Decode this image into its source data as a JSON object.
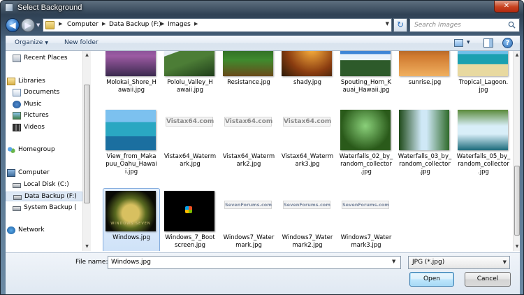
{
  "window": {
    "title": "Select Background",
    "close_glyph": "✕"
  },
  "nav": {
    "back_glyph": "◀",
    "forward_glyph": "▶",
    "refresh_glyph": "↻"
  },
  "address": {
    "crumbs": [
      "Computer",
      "Data Backup (F:)",
      "Images"
    ]
  },
  "search": {
    "placeholder": "Search Images"
  },
  "toolbar": {
    "organize": "Organize",
    "new_folder": "New folder",
    "help_glyph": "?"
  },
  "sidebar": {
    "items": [
      {
        "label": "Recent Places",
        "icon": "recent-places-icon"
      },
      {
        "label": "Libraries",
        "icon": "libraries-icon"
      },
      {
        "label": "Documents",
        "icon": "documents-icon"
      },
      {
        "label": "Music",
        "icon": "music-icon"
      },
      {
        "label": "Pictures",
        "icon": "pictures-icon"
      },
      {
        "label": "Videos",
        "icon": "videos-icon"
      },
      {
        "label": "Homegroup",
        "icon": "homegroup-icon"
      },
      {
        "label": "Computer",
        "icon": "computer-icon"
      },
      {
        "label": "Local Disk (C:)",
        "icon": "drive-icon"
      },
      {
        "label": "Data Backup (F:)",
        "icon": "drive-icon"
      },
      {
        "label": "System Backup (",
        "icon": "drive-icon"
      },
      {
        "label": "Network",
        "icon": "network-icon"
      }
    ]
  },
  "files": [
    {
      "name": "Molokai_Shore_Hawaii.jpg",
      "lines": [
        "Molokai_Shore_H",
        "awaii.jpg"
      ]
    },
    {
      "name": "Pololu_Valley_Hawaii.jpg",
      "lines": [
        "Pololu_Valley_H",
        "awaii.jpg"
      ]
    },
    {
      "name": "Resistance.jpg",
      "lines": [
        "Resistance.jpg"
      ]
    },
    {
      "name": "shady.jpg",
      "lines": [
        "shady.jpg"
      ]
    },
    {
      "name": "Spouting_Horn_Kauai_Hawaii.jpg",
      "lines": [
        "Spouting_Horn_K",
        "auai_Hawaii.jpg"
      ]
    },
    {
      "name": "sunrise.jpg",
      "lines": [
        "sunrise.jpg"
      ]
    },
    {
      "name": "Tropical_Lagoon.jpg",
      "lines": [
        "Tropical_Lagoon.",
        "jpg"
      ]
    },
    {
      "name": "View_from_Makapuu_Oahu_Hawaii.jpg",
      "lines": [
        "View_from_Maka",
        "puu_Oahu_Hawai",
        "i.jpg"
      ]
    },
    {
      "name": "Vistax64_Watermark.jpg",
      "lines": [
        "Vistax64_Waterm",
        "ark.jpg"
      ],
      "watermark": "Vistax64.com"
    },
    {
      "name": "Vistax64_Watermark2.jpg",
      "lines": [
        "Vistax64_Waterm",
        "ark2.jpg"
      ],
      "watermark": "Vistax64.com"
    },
    {
      "name": "Vistax64_Watermark3.jpg",
      "lines": [
        "Vistax64_Waterm",
        "ark3.jpg"
      ],
      "watermark": "Vistax64.com"
    },
    {
      "name": "Waterfalls_02_by_random_collector.jpg",
      "lines": [
        "Waterfalls_02_by_",
        "random_collector",
        ".jpg"
      ]
    },
    {
      "name": "Waterfalls_03_by_random_collector.jpg",
      "lines": [
        "Waterfalls_03_by_",
        "random_collector",
        ".jpg"
      ]
    },
    {
      "name": "Waterfalls_05_by_random_collector.jpg",
      "lines": [
        "Waterfalls_05_by_",
        "random_collector",
        ".jpg"
      ]
    },
    {
      "name": "Windows.jpg",
      "lines": [
        "Windows.jpg"
      ],
      "selected": true,
      "thumb_text": "WINDOWS SEVEN"
    },
    {
      "name": "Windows_7_Bootscreen.jpg",
      "lines": [
        "Windows_7_Boot",
        "screen.jpg"
      ]
    },
    {
      "name": "Windows7_Watermark.jpg",
      "lines": [
        "Windows7_Water",
        "mark.jpg"
      ],
      "sevenforums": "SevenForums.com"
    },
    {
      "name": "Windows7_Watermark2.jpg",
      "lines": [
        "Windows7_Water",
        "mark2.jpg"
      ],
      "sevenforums": "SevenForums.com"
    },
    {
      "name": "Windows7_Watermark3.jpg",
      "lines": [
        "Windows7_Water",
        "mark3.jpg"
      ],
      "sevenforums": "SevenForums.com"
    }
  ],
  "bottom": {
    "file_name_label": "File name:",
    "file_name_value": "Windows.jpg",
    "file_type": "JPG (*.jpg)",
    "open_label": "Open",
    "cancel_label": "Cancel"
  },
  "colors": {
    "accent": "#3c7fb1",
    "selection": "#cfe2f8",
    "close": "#c8421f"
  }
}
